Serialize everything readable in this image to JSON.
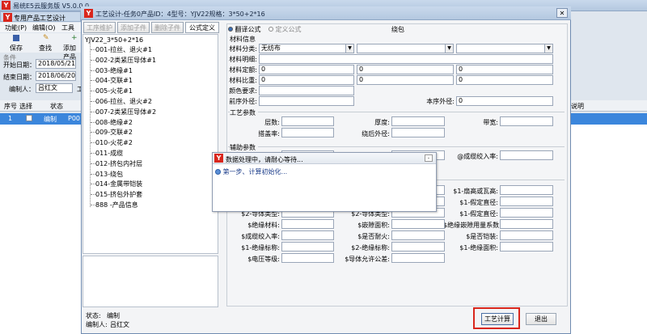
{
  "main": {
    "title": "易统E5云服务版 V5.0.0.0",
    "menu": [
      "功能(P)",
      "编辑(O)",
      "工具(T)"
    ],
    "panel_title": "专用产品工艺设计",
    "toolbar": [
      "保存",
      "查找",
      "添加产品"
    ],
    "section_label": "条件",
    "start_label": "开始日期：",
    "start_value": "2018/05/21",
    "end_label": "结束日期：",
    "end_value": "2018/06/20",
    "editor_label": "编制人：",
    "editor_value": "吕红文",
    "cut_char": "工",
    "table_headers": [
      "序号",
      "选择",
      "状态"
    ],
    "row": {
      "index": "1",
      "status": "编制",
      "code": "P00"
    },
    "right_header": "说明"
  },
  "dialog": {
    "title": "工艺设计-任务0产品ID：4型号：YJV22规格：3*50+2*16",
    "tabs": [
      "工序维护",
      "添加子件",
      "删除子件",
      "公式定义"
    ],
    "radio_labels": [
      "翻译公式",
      "定义公式"
    ],
    "tree_root": "YJV22_3*50+2*16",
    "tree_items": [
      "001-拉丝、退火#1",
      "002-2类紧压导体#1",
      "003-绝缘#1",
      "004-交联#1",
      "005-火花#1",
      "006-拉丝、退火#2",
      "007-2类紧压导体#2",
      "008-绝缘#2",
      "009-交联#2",
      "010-火花#2",
      "011-成缆",
      "012-挤包内衬层",
      "013-绕包",
      "014-金属带铠装",
      "015-挤包外护套",
      "888 -产品信息"
    ],
    "form_title": "绕包",
    "material": {
      "group": "材料信息",
      "labels": [
        "材料分类:",
        "材料明细:",
        "材料定额:",
        "材料比重:",
        "颜色要求:",
        "前序外径:"
      ],
      "class_value": "无纺布",
      "zeros": [
        "0",
        "0",
        "0",
        "0",
        "0",
        "0",
        "0"
      ],
      "next_od_label": "本序外径:",
      "next_od_value": "0"
    },
    "process": {
      "group": "工艺参数",
      "labels": [
        "层数:",
        "搭盖率:",
        "厚度:",
        "绕后外径:",
        "带宽:"
      ]
    },
    "aux": {
      "group": "辅助参数",
      "labels": [
        "@成缆绞入率:"
      ]
    },
    "calc": {
      "labels_right_col": [
        "$1-扇高或瓦高:",
        "$1-假定直径:",
        "$1-假定直径:",
        "$绝缘嵌隙用量系数:",
        "$是否铠装:",
        "$1-绝缘面积:"
      ],
      "labels_mid_col": [
        "$2-导体类型:",
        "$嵌隙面积:",
        "$是否耐火:",
        "$2-绝缘标称:",
        "$导体允许公差:"
      ],
      "labels_left_col": [
        "$2-导体类型:",
        "$绝缘材料:",
        "$成缆绞入率:",
        "$1-绝缘标称:",
        "$电压等级:"
      ]
    },
    "status_label": "状态:",
    "status_value": "编制",
    "editor_label": "编制人:",
    "editor_value": "吕红文",
    "btn_calc": "工艺计算",
    "btn_exit": "退出"
  },
  "progress": {
    "title": "数据处理中，请耐心等待...",
    "step": "第一步、计算初始化..."
  },
  "colors": {
    "highlight": "#d9261c",
    "selection": "#3b86dc"
  }
}
